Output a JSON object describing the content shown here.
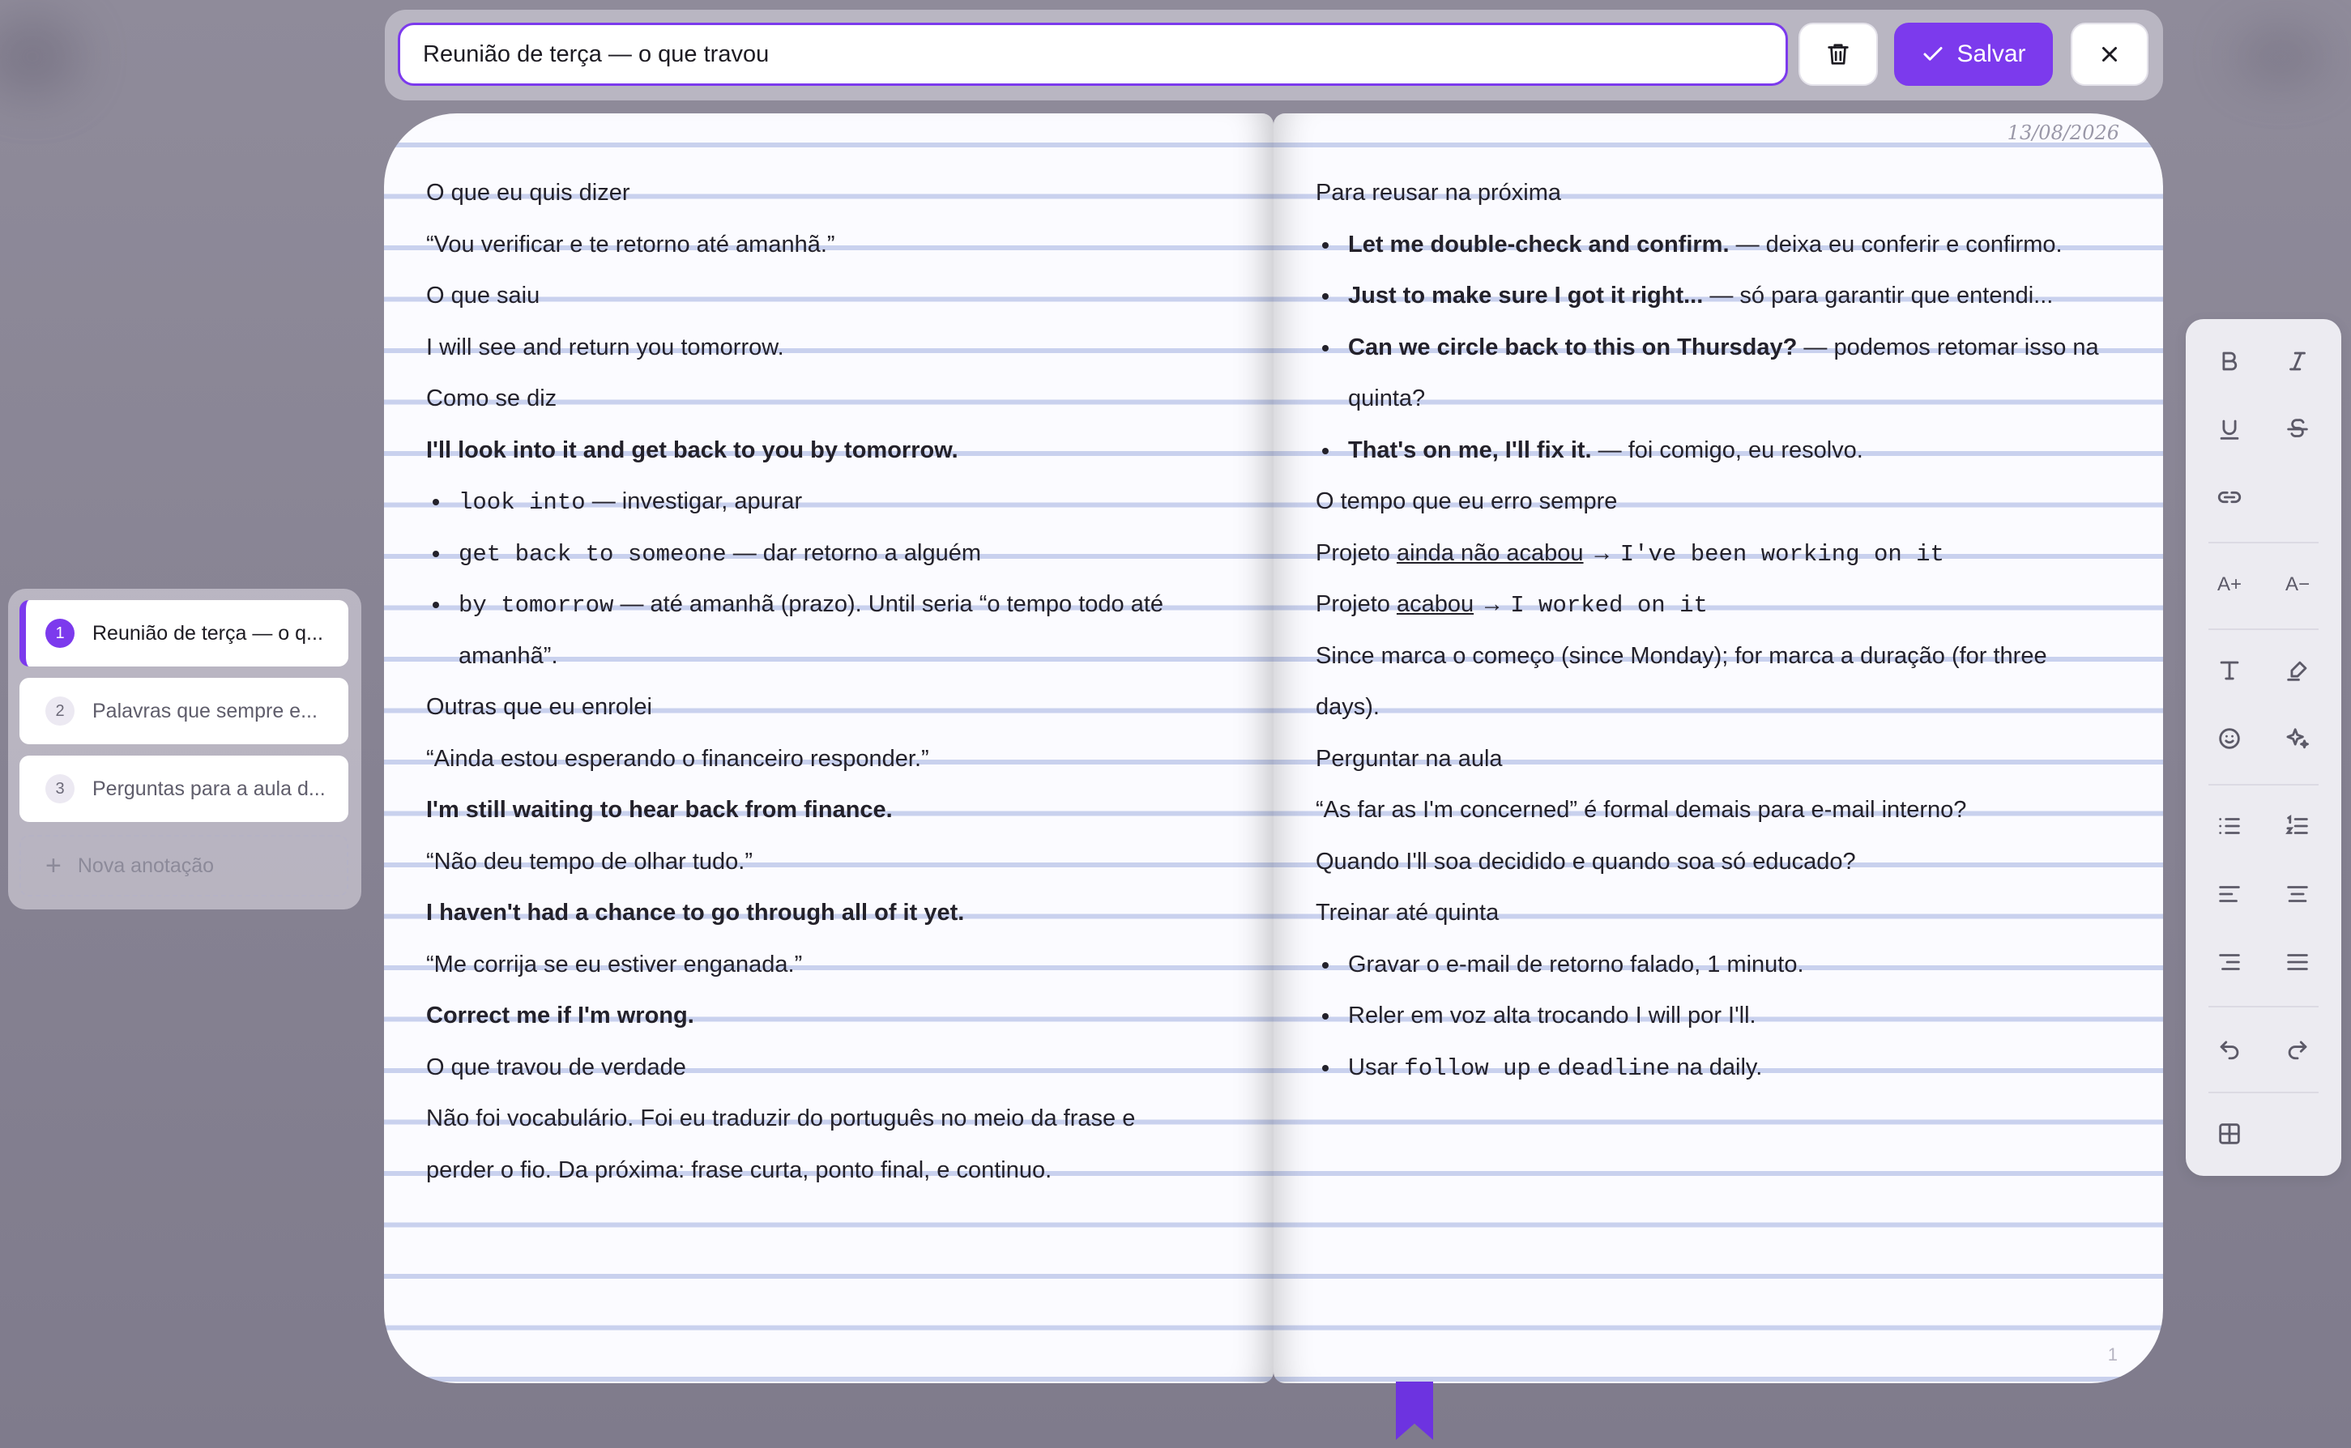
{
  "title_input": {
    "value": "Reunião de terça — o que travou"
  },
  "toolbar": {
    "save_label": "Salvar"
  },
  "left_page": {
    "lines": [
      {
        "t": "O que eu quis dizer"
      },
      {
        "t": "“Vou verificar e te retorno até amanhã.”"
      },
      {
        "t": "O que saiu"
      },
      {
        "t": "I will see and return you tomorrow."
      },
      {
        "t": "Como se diz"
      },
      {
        "t": "I'll look into it and get back to you by tomorrow."
      },
      {
        "code": "look into",
        "rest": " — investigar, apurar"
      },
      {
        "code": "get back to someone",
        "rest": " — dar retorno a alguém"
      },
      {
        "code": "by tomorrow",
        "rest": " — até amanhã (prazo). Until seria “o tempo todo até"
      },
      {
        "t": "amanhã”."
      },
      {
        "t": "Outras que eu enrolei"
      },
      {
        "t": "“Ainda estou esperando o financeiro responder.”"
      },
      {
        "t": "I'm still waiting to hear back from finance."
      },
      {
        "t": "“Não deu tempo de olhar tudo.”"
      },
      {
        "t": "I haven't had a chance to go through all of it yet."
      },
      {
        "t": "“Me corrija se eu estiver enganada.”"
      },
      {
        "t": "Correct me if I'm wrong."
      },
      {
        "t": "O que travou de verdade"
      },
      {
        "t": "Não foi vocabulário. Foi eu traduzir do português no meio da frase e"
      },
      {
        "t": "perder o fio. Da próxima: frase curta, ponto final, e continuo."
      }
    ]
  },
  "right_page": {
    "date": "13/08/2026",
    "page_number": "1",
    "lines": [
      {
        "t": "Para reusar na próxima"
      },
      {
        "b": "Let me double-check and confirm.",
        "rest": " — deixa eu conferir e confirmo."
      },
      {
        "b": "Just to make sure I got it right...",
        "rest": " — só para garantir que entendi..."
      },
      {
        "b": "Can we circle back to this on Thursday?",
        "rest": " — podemos retomar isso na"
      },
      {
        "t": "quinta?"
      },
      {
        "b": "That's on me, I'll fix it.",
        "rest": " — foi comigo, eu resolvo."
      },
      {
        "t": "O tempo que eu erro sempre"
      },
      {
        "pre": "Projeto ",
        "u": "ainda não acabou",
        "arrow": " → ",
        "code": "I've been working on it"
      },
      {
        "pre": "Projeto ",
        "u": "acabou",
        "arrow": " → ",
        "code": "I worked on it"
      },
      {
        "t": "Since marca o começo (since Monday); for marca a duração (for three"
      },
      {
        "t": "days)."
      },
      {
        "t": "Perguntar na aula"
      },
      {
        "t": "“As far as I'm concerned” é formal demais para e-mail interno?"
      },
      {
        "t": "Quando I'll soa decidido e quando soa só educado?"
      },
      {
        "t": "Treinar até quinta"
      },
      {
        "t": "Gravar o e-mail de retorno falado, 1 minuto."
      },
      {
        "t": "Reler em voz alta trocando I will por I'll."
      },
      {
        "pre": "Usar ",
        "code": "follow up",
        "mid": " e ",
        "code2": "deadline",
        "rest": " na daily."
      }
    ]
  },
  "notes": {
    "items": [
      {
        "num": "1",
        "label": "Reunião de terça — o q..."
      },
      {
        "num": "2",
        "label": "Palavras que sempre e..."
      },
      {
        "num": "3",
        "label": "Perguntas para a aula d..."
      }
    ],
    "new_label": "Nova anotação"
  },
  "format_toolbar": {
    "font_increase": "A+",
    "font_decrease": "A−"
  },
  "colors": {
    "accent": "#7c3aed",
    "page": "#fbfbff",
    "ruled_line": "#c9d1ee"
  }
}
